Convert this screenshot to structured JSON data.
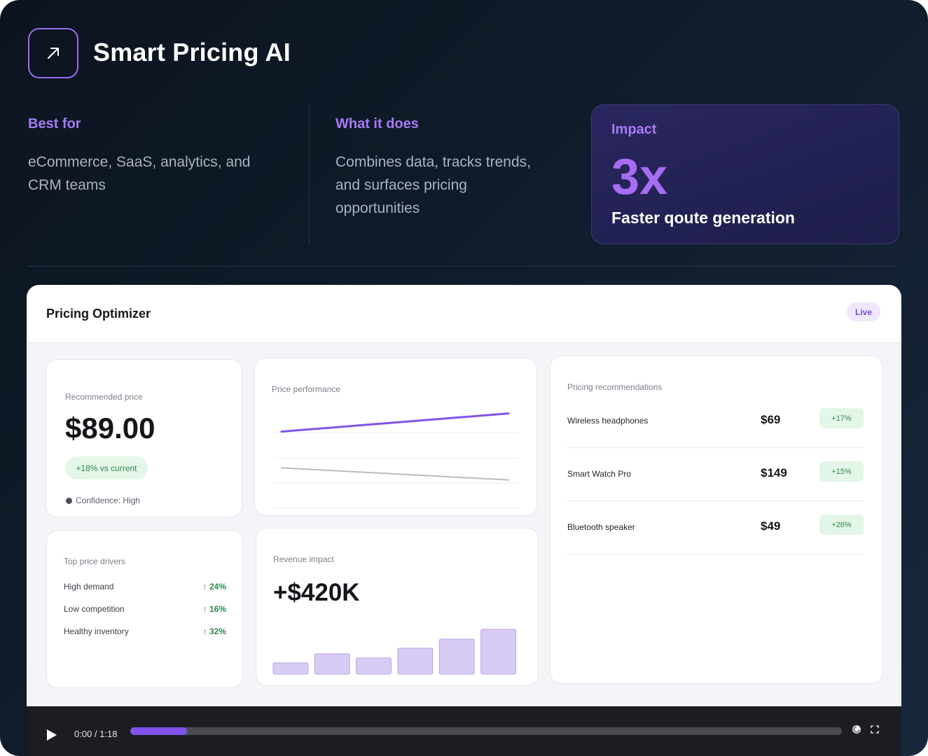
{
  "app": {
    "title": "Smart Pricing AI",
    "logo_icon": "arrow-up-right-icon",
    "accent": "#9b6cf0"
  },
  "info": {
    "best_for": {
      "heading": "Best for",
      "lines": [
        "eCommerce, SaaS, analytics, and",
        "CRM teams"
      ]
    },
    "what_it_does": {
      "heading": "What it does",
      "lines": [
        "Combines data, tracks trends,",
        "and surfaces pricing",
        "opportunities"
      ]
    }
  },
  "impact": {
    "label": "Impact",
    "value": "3x",
    "caption": "Faster qoute generation"
  },
  "dashboard": {
    "title": "Pricing Optimizer",
    "status_badge": "Live",
    "recommended": {
      "label": "Recommended price",
      "price": "$89.00",
      "delta": "+18% vs current",
      "confidence": "Confidence: High"
    },
    "performance": {
      "label": "Price performance"
    },
    "drivers": {
      "label": "Top price drivers",
      "items": [
        {
          "name": "High demand",
          "value": "24%",
          "icon": "arrow-up-icon"
        },
        {
          "name": "Low competition",
          "value": "16%",
          "icon": "arrow-up-icon"
        },
        {
          "name": "Healthy inventory",
          "value": "32%",
          "icon": "arrow-up-icon"
        }
      ]
    },
    "revenue": {
      "label": "Revenue impact",
      "value": "+$420K"
    },
    "recommendations": {
      "label": "Pricing recommendations",
      "items": [
        {
          "name": "Wireless headphones",
          "price": "$69",
          "change": "+17%"
        },
        {
          "name": "Smart Watch Pro",
          "price": "$149",
          "change": "+15%"
        },
        {
          "name": "Bluetooth speaker",
          "price": "$49",
          "change": "+26%"
        }
      ]
    }
  },
  "video": {
    "time": "0:00 / 1:18",
    "progress": 0.08,
    "icons": [
      "play-icon",
      "volume-icon",
      "fullscreen-icon"
    ]
  },
  "chart_data": [
    {
      "type": "line",
      "title": "Price performance",
      "x": [
        0,
        1,
        2,
        3,
        4,
        5,
        6
      ],
      "series": [
        {
          "values": [
            7.6,
            7.9,
            8.2,
            8.5,
            8.8,
            9.1,
            9.4
          ],
          "color": "#8153ea"
        },
        {
          "values": [
            4.0,
            3.8,
            3.6,
            3.4,
            3.2,
            3.0,
            2.8
          ],
          "color": "#b9bcc5"
        }
      ],
      "ylim": [
        0,
        10
      ],
      "grid": true
    },
    {
      "type": "bar",
      "title": "Revenue impact",
      "categories": [
        "1",
        "2",
        "3",
        "4",
        "5",
        "6"
      ],
      "values": [
        16,
        29,
        23,
        37,
        50,
        64
      ],
      "ylim": [
        0,
        70
      ],
      "color": "#d9ccf4"
    }
  ]
}
